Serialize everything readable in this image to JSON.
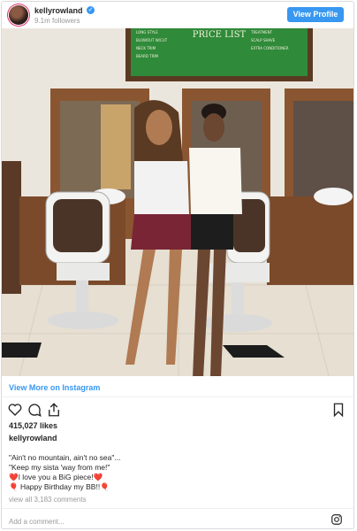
{
  "header": {
    "username": "kellyrowland",
    "followers": "9.1m followers",
    "verified_mark": "✓",
    "view_profile_label": "View Profile"
  },
  "photo": {
    "sign_title": "PRICE LIST",
    "sign_left": [
      "LONG STYLE",
      "BLOWOUT W/CUT",
      "NECK TRIM",
      "BEARD TRIM"
    ],
    "sign_right": [
      "TREATMENT",
      "SCALP SHAVE",
      "EXTRA CONDITIONER"
    ]
  },
  "view_more_label": "View More on Instagram",
  "icons": {
    "like": "heart-icon",
    "comment": "comment-icon",
    "share": "share-icon",
    "save": "bookmark-icon",
    "instagram": "instagram-icon"
  },
  "likes": "415,027 likes",
  "owner_username": "kellyrowland",
  "caption_lines": [
    "\"Ain't no mountain, ain't no sea\"...",
    "\"Keep my sista 'way from me!\"",
    "❤️I love you a BiG piece!❤️",
    "🎈 Happy Birthday my BB!!🎈"
  ],
  "comments_link": "view all 3,183 comments",
  "add_comment_placeholder": "Add a comment...",
  "colors": {
    "accent": "#3897f0",
    "border": "#dbdbdb",
    "muted": "#999999"
  }
}
